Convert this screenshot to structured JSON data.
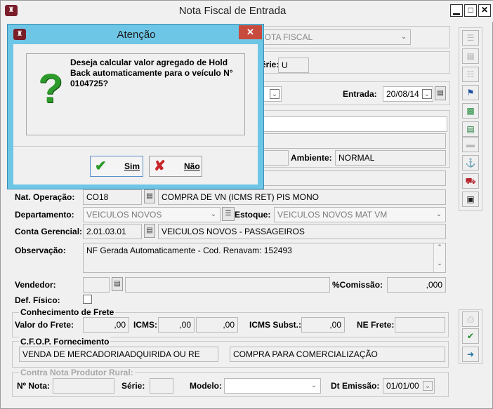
{
  "window": {
    "title": "Nota Fiscal de Entrada",
    "minimize": "▁",
    "maximize": "□",
    "close": "✕"
  },
  "header": {
    "tipo_nota_value": "NOTA FISCAL",
    "serie_label": "Série:",
    "serie_value": "U",
    "entrada_label": "Entrada:",
    "entrada_value": "20/08/14",
    "ambiente_label": "Ambiente:",
    "ambiente_value": "NORMAL"
  },
  "form": {
    "nat_operacao_label": "Nat. Operação:",
    "nat_operacao_code": "CO18",
    "nat_operacao_desc": "COMPRA DE VN (ICMS RET) PIS MONO",
    "departamento_label": "Departamento:",
    "departamento_value": "VEICULOS NOVOS",
    "estoque_label": "Estoque:",
    "estoque_value": "VEICULOS NOVOS MAT  VM",
    "conta_label": "Conta Gerencial:",
    "conta_code": "2.01.03.01",
    "conta_desc": "VEICULOS NOVOS - PASSAGEIROS",
    "observacao_label": "Observação:",
    "observacao_value": "NF Gerada Automaticamente - Cod. Renavam: 152493",
    "vendedor_label": "Vendedor:",
    "comissao_label": "%Comissão:",
    "comissao_value": ",000",
    "def_fisico_label": "Def. Físico:"
  },
  "frete": {
    "title": "Conhecimento de Frete",
    "valor_label": "Valor do Frete:",
    "valor_value": ",00",
    "icms_label": "ICMS:",
    "icms_value1": ",00",
    "icms_value2": ",00",
    "icms_subst_label": "ICMS Subst.:",
    "icms_subst_value": ",00",
    "ne_frete_label": "NE Frete:"
  },
  "cfop": {
    "title": "C.F.O.P. Fornecimento",
    "value1": "VENDA DE MERCADORIAADQUIRIDA OU RE",
    "value2": "COMPRA PARA COMERCIALIZAÇÃO"
  },
  "contra_nota": {
    "title": "Contra Nota Produtor Rural:",
    "nro_label": "Nº Nota:",
    "serie_label": "Série:",
    "modelo_label": "Modelo:",
    "dt_emissao_label": "Dt Emissão:",
    "dt_emissao_value": "01/01/00"
  },
  "dialog": {
    "title": "Atenção",
    "close": "✕",
    "message": "Deseja calcular valor agregado de Hold Back automaticamente para o veículo N° 0104725?",
    "yes_label": "Sim",
    "no_label": "Não"
  },
  "icons": {
    "app": "car-icon",
    "question": "question-mark-icon",
    "yes": "check-icon",
    "no": "x-icon"
  },
  "colors": {
    "dialog_frame": "#6ec6e6",
    "dialog_close": "#c74a3d",
    "question_icon": "#2e9a2b"
  }
}
